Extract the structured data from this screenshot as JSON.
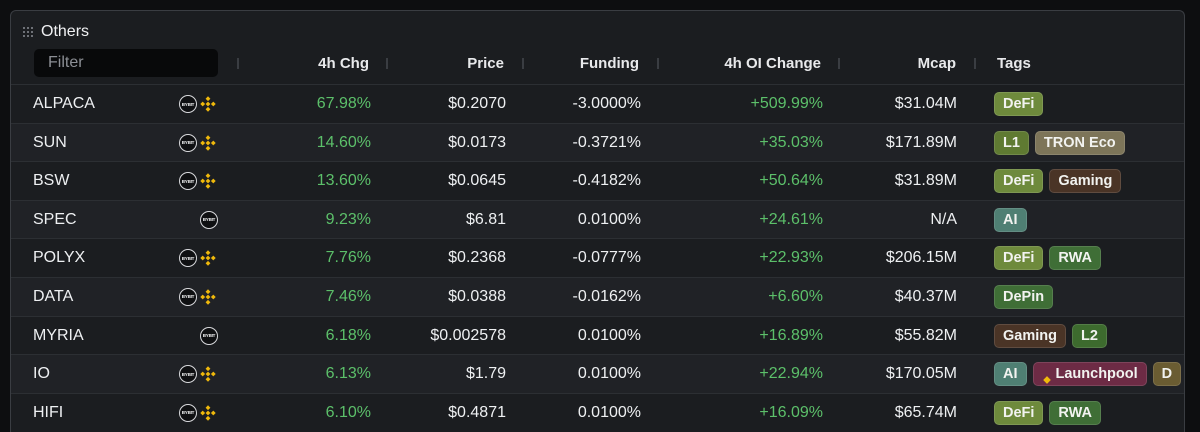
{
  "panel": {
    "title": "Others"
  },
  "filter": {
    "placeholder": "Filter",
    "value": ""
  },
  "columns": {
    "chg": "4h Chg",
    "price": "Price",
    "funding": "Funding",
    "oi": "4h OI Change",
    "mcap": "Mcap",
    "tags": "Tags"
  },
  "exchange_icons": {
    "bybit": "BYBIT",
    "binance": "binance-icon"
  },
  "tag_colors": {
    "DeFi": "#6e8a3c",
    "L1": "#5f7a32",
    "TRON Eco": "#7d7559",
    "Gaming": "#4a3426",
    "AI": "#4f7f73",
    "RWA": "#3f6e36",
    "DePin": "#3f6e36",
    "L2": "#3d6b2e",
    "Launchpool": "#6d2b45",
    "D": "#6a5c32"
  },
  "rows": [
    {
      "symbol": "ALPACA",
      "exchanges": [
        "bybit",
        "binance"
      ],
      "chg": "67.98%",
      "price": "$0.2070",
      "funding": "-3.0000%",
      "oi": "+509.99%",
      "mcap": "$31.04M",
      "tags": [
        "DeFi"
      ]
    },
    {
      "symbol": "SUN",
      "exchanges": [
        "bybit",
        "binance"
      ],
      "chg": "14.60%",
      "price": "$0.0173",
      "funding": "-0.3721%",
      "oi": "+35.03%",
      "mcap": "$171.89M",
      "tags": [
        "L1",
        "TRON Eco"
      ]
    },
    {
      "symbol": "BSW",
      "exchanges": [
        "bybit",
        "binance"
      ],
      "chg": "13.60%",
      "price": "$0.0645",
      "funding": "-0.4182%",
      "oi": "+50.64%",
      "mcap": "$31.89M",
      "tags": [
        "DeFi",
        "Gaming"
      ]
    },
    {
      "symbol": "SPEC",
      "exchanges": [
        "bybit"
      ],
      "chg": "9.23%",
      "price": "$6.81",
      "funding": "0.0100%",
      "oi": "+24.61%",
      "mcap": "N/A",
      "tags": [
        "AI"
      ]
    },
    {
      "symbol": "POLYX",
      "exchanges": [
        "bybit",
        "binance"
      ],
      "chg": "7.76%",
      "price": "$0.2368",
      "funding": "-0.0777%",
      "oi": "+22.93%",
      "mcap": "$206.15M",
      "tags": [
        "DeFi",
        "RWA"
      ]
    },
    {
      "symbol": "DATA",
      "exchanges": [
        "bybit",
        "binance"
      ],
      "chg": "7.46%",
      "price": "$0.0388",
      "funding": "-0.0162%",
      "oi": "+6.60%",
      "mcap": "$40.37M",
      "tags": [
        "DePin"
      ]
    },
    {
      "symbol": "MYRIA",
      "exchanges": [
        "bybit"
      ],
      "chg": "6.18%",
      "price": "$0.002578",
      "funding": "0.0100%",
      "oi": "+16.89%",
      "mcap": "$55.82M",
      "tags": [
        "Gaming",
        "L2"
      ]
    },
    {
      "symbol": "IO",
      "exchanges": [
        "bybit",
        "binance"
      ],
      "chg": "6.13%",
      "price": "$1.79",
      "funding": "0.0100%",
      "oi": "+22.94%",
      "mcap": "$170.05M",
      "tags": [
        "AI",
        "Launchpool",
        "D"
      ]
    },
    {
      "symbol": "HIFI",
      "exchanges": [
        "bybit",
        "binance"
      ],
      "chg": "6.10%",
      "price": "$0.4871",
      "funding": "0.0100%",
      "oi": "+16.09%",
      "mcap": "$65.74M",
      "tags": [
        "DeFi",
        "RWA"
      ]
    }
  ]
}
